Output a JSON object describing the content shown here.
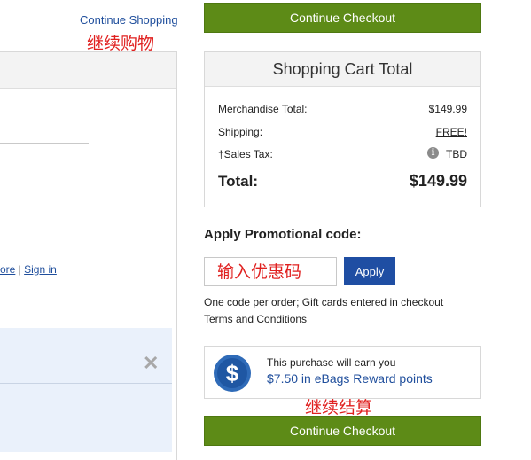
{
  "left": {
    "continue_shopping": "Continue Shopping",
    "annotation_continue": "继续购物",
    "links_prefix": "ore",
    "links_separator": " | ",
    "sign_in": "Sign in",
    "close_glyph": "✕"
  },
  "checkout": {
    "button_label": "Continue Checkout",
    "annotation": "继续结算"
  },
  "cart_total": {
    "title": "Shopping Cart Total",
    "merchandise_label": "Merchandise Total:",
    "merchandise_value": "$149.99",
    "shipping_label": "Shipping:",
    "shipping_value": "FREE!",
    "tax_label": "†Sales Tax:",
    "tax_value": "TBD",
    "total_label": "Total:",
    "total_value": "$149.99"
  },
  "promo": {
    "title": "Apply Promotional code:",
    "input_placeholder": "输入优惠码",
    "apply_label": "Apply",
    "note": "One code per order; Gift cards entered in checkout",
    "terms": "Terms and Conditions"
  },
  "reward": {
    "line1": "This purchase will earn you",
    "line2": "$7.50 in eBags Reward points",
    "icon_glyph": "$"
  },
  "icons": {
    "info": "info-icon",
    "dollar": "dollar-coin-icon",
    "close": "close-icon"
  },
  "colors": {
    "checkout_green": "#5d8b17",
    "apply_blue": "#1f4ea3",
    "link_blue": "#1f4e9c",
    "annotation_red": "#e0201f"
  }
}
